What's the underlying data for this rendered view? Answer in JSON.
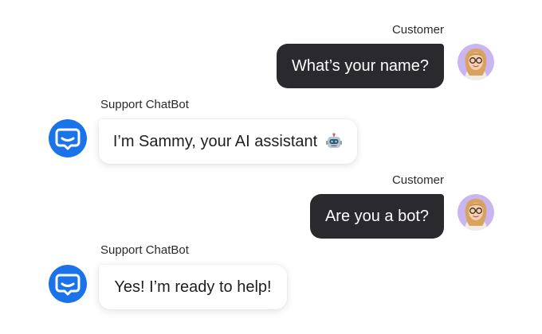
{
  "messages": [
    {
      "role": "customer",
      "sender": "Customer",
      "text": "What’s your name?"
    },
    {
      "role": "bot",
      "sender": "Support ChatBot",
      "text": "I’m Sammy, your AI assistant",
      "emoji": "robot-face-icon"
    },
    {
      "role": "customer",
      "sender": "Customer",
      "text": "Are you a bot?"
    },
    {
      "role": "bot",
      "sender": "Support ChatBot",
      "text": "Yes! I’m ready to help!"
    }
  ],
  "colors": {
    "customer_bubble": "#2a2a2e",
    "bot_bubble": "#ffffff",
    "bot_icon": "#1a73e8",
    "avatar_bg": "#c9b5f0"
  },
  "icons": {
    "customer_avatar": "customer-avatar",
    "bot_avatar": "chat-bubble-icon"
  }
}
